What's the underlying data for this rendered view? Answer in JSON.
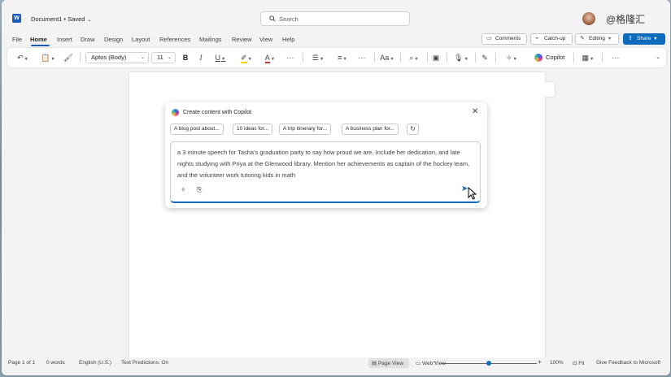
{
  "titlebar": {
    "app_icon": "word-logo-icon",
    "app_letter": "W",
    "doc_title": "Document1 • Saved",
    "title_chevron": "⌄",
    "search_placeholder": "Search",
    "watermark": "@格隆汇"
  },
  "menu": {
    "items": [
      "File",
      "Home",
      "Insert",
      "Draw",
      "Design",
      "Layout",
      "References",
      "Mailings",
      "Review",
      "View",
      "Help"
    ],
    "active": "Home",
    "comments": "Comments",
    "catchup": "Catch-up",
    "editing": "Editing",
    "share": "Share"
  },
  "ribbon": {
    "font_name": "Aptos (Body)",
    "font_size": "11",
    "bold": "B",
    "italic": "I",
    "underline": "U",
    "font_color_letter": "A",
    "more": "···",
    "copilot": "Copilot",
    "highlight_color": "#ffd700",
    "font_color": "#d13438"
  },
  "copilot_panel": {
    "title": "Create content with Copilot",
    "close": "✕",
    "chips": [
      "A blog post about...",
      "10 ideas for...",
      "A trip itinerary for...",
      "A business plan for..."
    ],
    "refresh": "↻",
    "prompt": "a 3 minute speech for Tasha's graduation party to say how proud we are. Include her dedication, and late nights studying with Priya at the Glenwood library. Mention her achievements as captain of the hockey team, and the volunteer work tutoring kids in math"
  },
  "statusbar": {
    "page": "Page 1 of 1",
    "words": "0 words",
    "language": "English (U.S.)",
    "text_predictions": "Text Predictions: On",
    "page_view": "Page View",
    "web_view": "Web View",
    "zoom_out": "−",
    "zoom_in": "+",
    "zoom": "100%",
    "fit": "Fit",
    "feedback": "Give Feedback to Microsoft",
    "zoom_level": 0.5
  },
  "colors": {
    "accent": "#0f6cbd",
    "word_blue": "#185abd"
  }
}
